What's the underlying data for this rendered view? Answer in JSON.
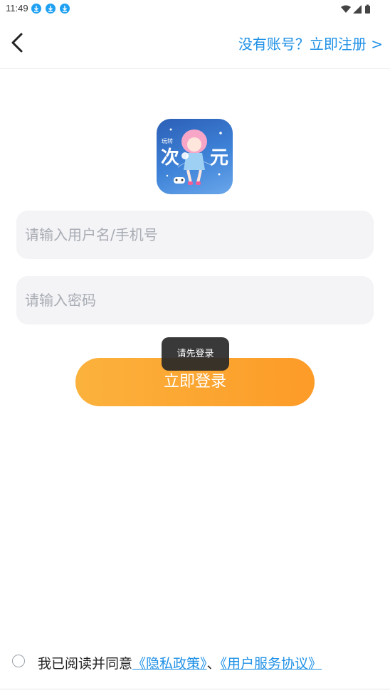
{
  "status_bar": {
    "time": "11:49",
    "notification_icons": [
      "download-icon",
      "download-icon",
      "download-icon"
    ],
    "system_icons": [
      "wifi-icon",
      "signal-icon",
      "battery-icon"
    ]
  },
  "header": {
    "back_icon": "chevron-left-icon",
    "register_link": "没有账号？立即注册 >"
  },
  "logo": {
    "small_text": "玩转",
    "char_left": "次",
    "char_right": "元"
  },
  "form": {
    "username_placeholder": "请输入用户名/手机号",
    "username_value": "",
    "password_placeholder": "请输入密码",
    "password_value": ""
  },
  "login_button": "立即登录",
  "toast": "请先登录",
  "agreement": {
    "prefix": "我已阅读并同意",
    "privacy_link": "《隐私政策》",
    "separator": "、",
    "service_link": "《用户服务协议》",
    "checked": false
  },
  "colors": {
    "accent_blue": "#1e90e6",
    "button_orange_start": "#fbb23d",
    "button_orange_end": "#fd9b27",
    "input_bg": "#f4f4f6"
  }
}
